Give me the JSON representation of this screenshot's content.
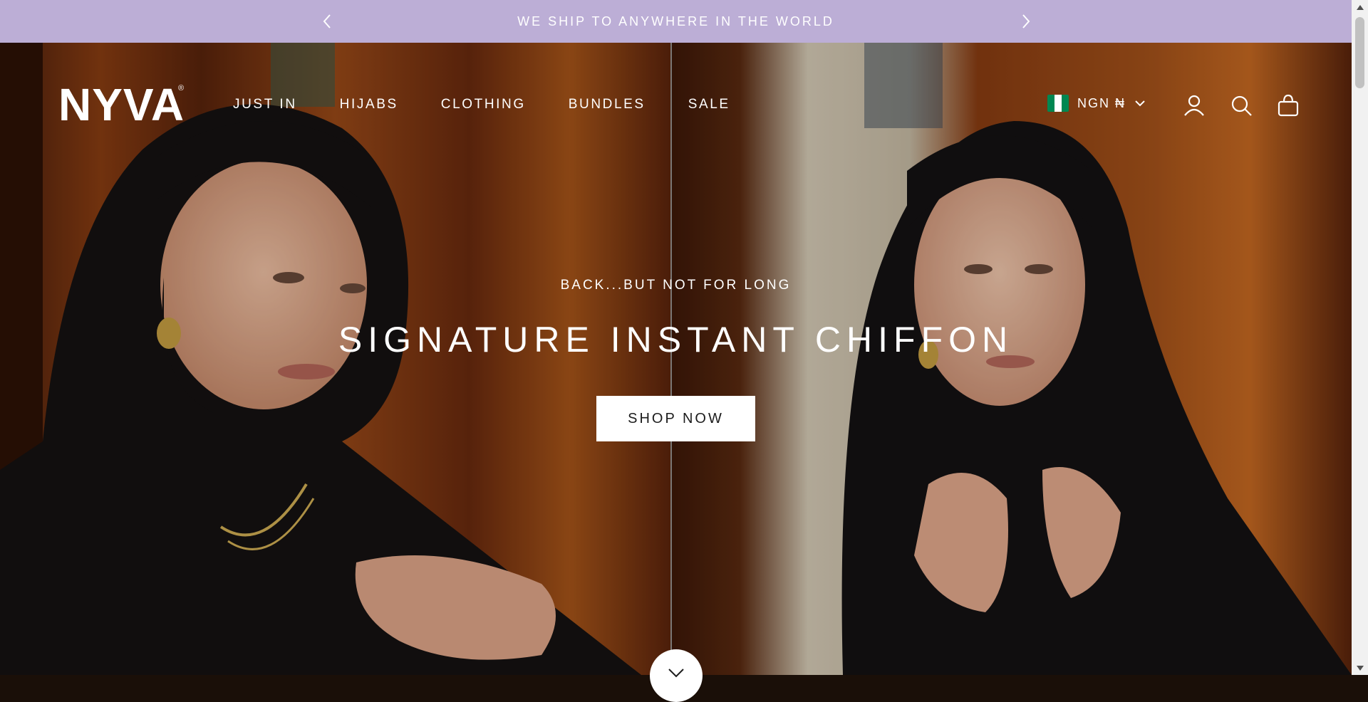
{
  "announcement": {
    "text": "WE SHIP TO ANYWHERE IN THE WORLD",
    "prev_icon": "chevron-left-icon",
    "next_icon": "chevron-right-icon"
  },
  "header": {
    "logo": "NYVA",
    "logo_mark": "®",
    "nav": [
      "JUST IN",
      "HIJABS",
      "CLOTHING",
      "BUNDLES",
      "SALE"
    ],
    "currency": {
      "label": "NGN ₦",
      "flag": "nigeria-flag-icon",
      "flag_colors": [
        "#008751",
        "#ffffff",
        "#008751"
      ]
    },
    "icons": [
      "account-icon",
      "search-icon",
      "cart-bag-icon"
    ]
  },
  "hero": {
    "subtitle": "BACK...BUT NOT FOR LONG",
    "title": "SIGNATURE INSTANT CHIFFON",
    "cta": "SHOP NOW",
    "scroll_icon": "chevron-down-icon"
  },
  "colors": {
    "announcement_bg": "#bcaed6",
    "text_light": "#ffffff",
    "button_bg": "#ffffff",
    "button_text": "#1c1c1c"
  }
}
